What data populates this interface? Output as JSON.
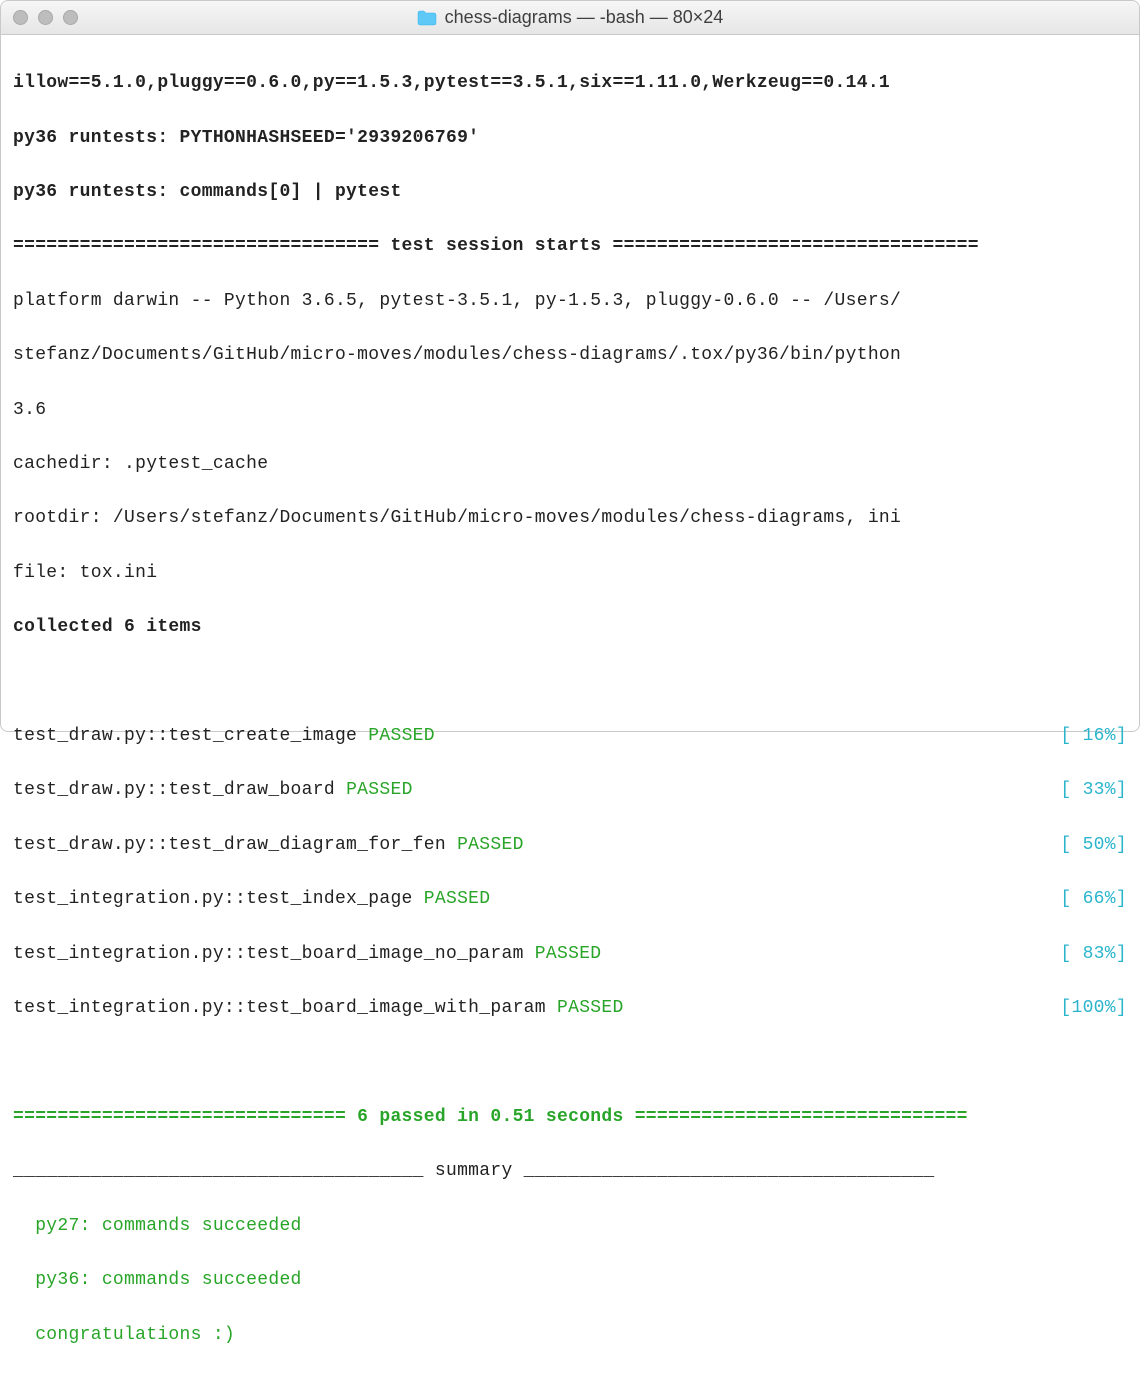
{
  "window": {
    "title": "chess-diagrams — -bash — 80×24"
  },
  "lines": {
    "deps": "illow==5.1.0,pluggy==0.6.0,py==1.5.3,pytest==3.5.1,six==1.11.0,Werkzeug==0.14.1",
    "hashseed": "py36 runtests: PYTHONHASHSEED='2939206769'",
    "commands": "py36 runtests: commands[0] | pytest",
    "session_header": "================================= test session starts =================================",
    "platform": "platform darwin -- Python 3.6.5, pytest-3.5.1, py-1.5.3, pluggy-0.6.0 -- /Users/",
    "platform2": "stefanz/Documents/GitHub/micro-moves/modules/chess-diagrams/.tox/py36/bin/python",
    "platform3": "3.6",
    "cachedir": "cachedir: .pytest_cache",
    "rootdir": "rootdir: /Users/stefanz/Documents/GitHub/micro-moves/modules/chess-diagrams, ini",
    "rootdir2": "file: tox.ini",
    "collected": "collected 6 items"
  },
  "tests": [
    {
      "name": "test_draw.py::test_create_image ",
      "status": "PASSED",
      "pct": "[ 16%]"
    },
    {
      "name": "test_draw.py::test_draw_board ",
      "status": "PASSED",
      "pct": "[ 33%]"
    },
    {
      "name": "test_draw.py::test_draw_diagram_for_fen ",
      "status": "PASSED",
      "pct": "[ 50%]"
    },
    {
      "name": "test_integration.py::test_index_page ",
      "status": "PASSED",
      "pct": "[ 66%]"
    },
    {
      "name": "test_integration.py::test_board_image_no_param ",
      "status": "PASSED",
      "pct": "[ 83%]"
    },
    {
      "name": "test_integration.py::test_board_image_with_param ",
      "status": "PASSED",
      "pct": "[100%]"
    }
  ],
  "footer": {
    "passed": "============================== 6 passed in 0.51 seconds ==============================",
    "summary": "_____________________________________ summary _____________________________________",
    "py27": "  py27: commands succeeded",
    "py36": "  py36: commands succeeded",
    "congrats": "  congratulations :)"
  }
}
